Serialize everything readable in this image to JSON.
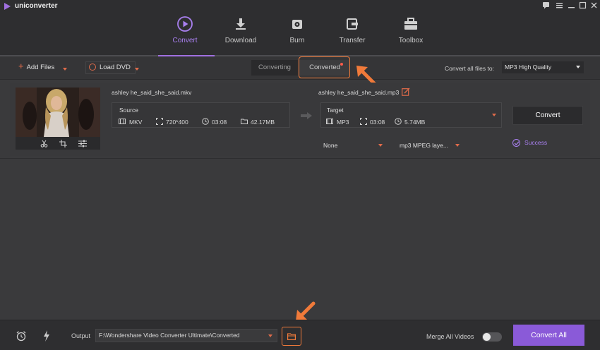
{
  "app": {
    "name": "uniconverter",
    "brand_color": "#a070e0",
    "highlight_color": "#f07a3a"
  },
  "window_controls": [
    "chat-icon",
    "menu-icon",
    "minimize-icon",
    "maximize-icon",
    "close-icon"
  ],
  "nav": {
    "items": [
      {
        "label": "Convert",
        "icon": "play-circle-icon",
        "active": true
      },
      {
        "label": "Download",
        "icon": "download-icon",
        "active": false
      },
      {
        "label": "Burn",
        "icon": "disc-icon",
        "active": false
      },
      {
        "label": "Transfer",
        "icon": "transfer-icon",
        "active": false
      },
      {
        "label": "Toolbox",
        "icon": "toolbox-icon",
        "active": false
      }
    ]
  },
  "toolbar": {
    "add_files": "Add Files",
    "load_dvd": "Load DVD",
    "tab_converting": "Converting",
    "tab_converted": "Converted",
    "convert_all_label": "Convert all files to:",
    "convert_all_value": "MP3 High Quality"
  },
  "file": {
    "source_name": "ashley he_said_she_said.mkv",
    "target_name": "ashley he_said_she_said.mp3",
    "source": {
      "label": "Source",
      "format": "MKV",
      "resolution": "720*400",
      "duration": "03:08",
      "size": "42.17MB"
    },
    "target": {
      "label": "Target",
      "format": "MP3",
      "duration": "03:08",
      "size": "5.74MB"
    },
    "subtitle_select": "None",
    "audio_select": "mp3 MPEG laye...",
    "convert_button": "Convert",
    "status": "Success"
  },
  "bottom": {
    "output_label": "Output",
    "output_path": "F:\\Wondershare Video Converter Ultimate\\Converted",
    "merge_label": "Merge All Videos",
    "merge_on": false,
    "convert_all_button": "Convert All"
  }
}
